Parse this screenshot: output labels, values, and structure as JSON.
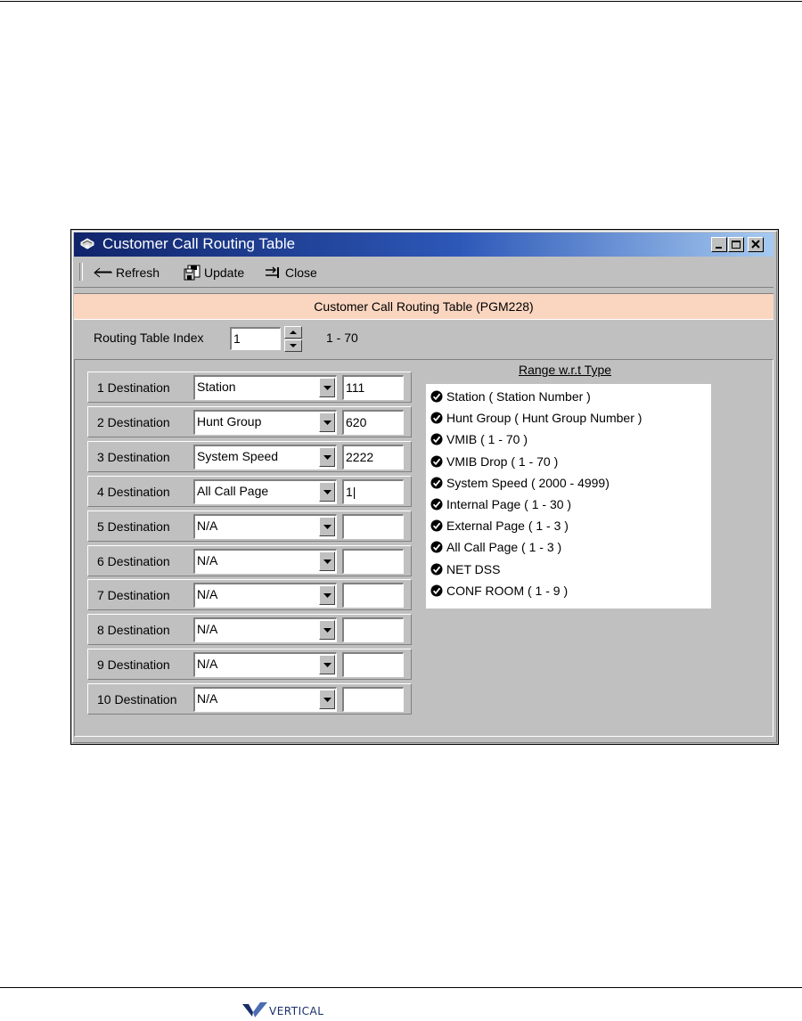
{
  "window": {
    "title": "Customer Call Routing Table"
  },
  "toolbar": {
    "refresh_label": "Refresh",
    "update_label": "Update",
    "close_label": "Close"
  },
  "banner": "Customer Call Routing Table (PGM228)",
  "index": {
    "label": "Routing Table Index",
    "value": "1",
    "range": "1 - 70"
  },
  "destinations": [
    {
      "label": "1 Destination",
      "type": "Station",
      "value": "111"
    },
    {
      "label": "2 Destination",
      "type": "Hunt Group",
      "value": "620"
    },
    {
      "label": "3 Destination",
      "type": "System Speed",
      "value": "2222"
    },
    {
      "label": "4 Destination",
      "type": "All Call Page",
      "value": "1|"
    },
    {
      "label": "5 Destination",
      "type": "N/A",
      "value": ""
    },
    {
      "label": "6 Destination",
      "type": "N/A",
      "value": ""
    },
    {
      "label": "7 Destination",
      "type": "N/A",
      "value": ""
    },
    {
      "label": "8 Destination",
      "type": "N/A",
      "value": ""
    },
    {
      "label": "9 Destination",
      "type": "N/A",
      "value": ""
    },
    {
      "label": "10 Destination",
      "type": "N/A",
      "value": ""
    }
  ],
  "range_panel": {
    "title": "Range w.r.t Type",
    "items": [
      "Station ( Station Number )",
      "Hunt Group ( Hunt Group Number )",
      "VMIB ( 1 - 70 )",
      "VMIB Drop ( 1 - 70 )",
      "System Speed ( 2000 - 4999)",
      "Internal Page ( 1 - 30 )",
      "External Page ( 1 - 3 )",
      "All Call Page ( 1 - 3 )",
      "NET DSS",
      "CONF ROOM ( 1 - 9 )"
    ]
  },
  "footer": {
    "logo_text": "VERTICAL"
  },
  "colors": {
    "title_bar_start": "#10246a",
    "title_bar_end": "#a6caf0",
    "window_bg": "#c0c0c0",
    "banner_bg": "#fad6c1",
    "logo_blue": "#1a2f6a"
  }
}
